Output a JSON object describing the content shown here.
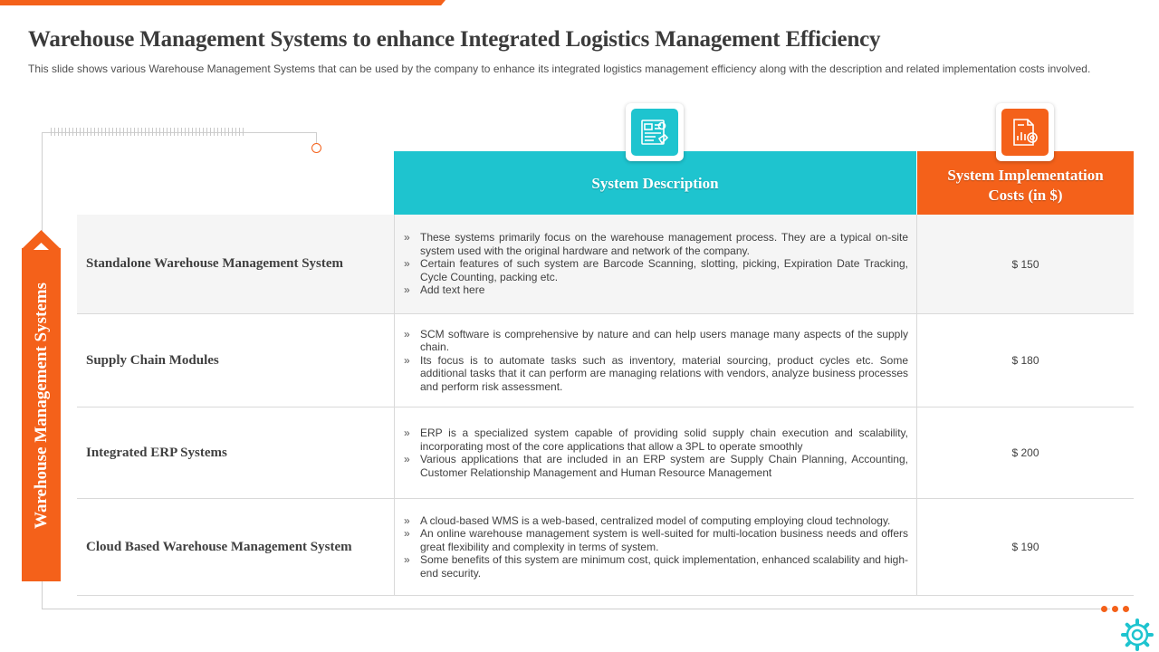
{
  "title": "Warehouse Management Systems to enhance Integrated Logistics Management Efficiency",
  "subtitle": "This slide shows various  Warehouse Management  Systems that can be used by the company to enhance its integrated  logistics management  efficiency along with the description and related implementation costs involved.",
  "banner_label": "Warehouse  Management  Systems",
  "headers": {
    "description": "System Description",
    "cost": "System Implementation Costs (in $)"
  },
  "icons": {
    "description": "document-blueprint-icon",
    "cost": "report-settings-icon"
  },
  "colors": {
    "teal": "#1ec4cf",
    "orange": "#f4611a"
  },
  "rows": [
    {
      "name": "Standalone Warehouse Management System",
      "bullets": [
        "These systems primarily focus on the warehouse management process. They are a typical on-site system used with the original hardware and network of the company.",
        "Certain features of such system are Barcode Scanning, slotting, picking, Expiration Date Tracking, Cycle Counting, packing etc.",
        "Add text here"
      ],
      "cost": "$ 150"
    },
    {
      "name": "Supply  Chain Modules",
      "bullets": [
        "SCM software is comprehensive by nature and can help users manage many aspects of the supply chain.",
        "Its focus is to automate tasks such as inventory, material sourcing, product cycles etc. Some additional tasks that it can perform are managing relations with vendors, analyze business processes and perform risk assessment."
      ],
      "cost": "$ 180"
    },
    {
      "name": "Integrated  ERP Systems",
      "bullets": [
        "ERP is a specialized system capable of providing solid supply chain execution and scalability, incorporating most of the core applications that allow a 3PL to operate smoothly",
        "Various applications that are included in an ERP system are Supply Chain Planning, Accounting, Customer Relationship Management and Human Resource Management"
      ],
      "cost": "$ 200"
    },
    {
      "name": "Cloud  Based Warehouse  Management  System",
      "bullets": [
        "A cloud-based WMS is a web-based, centralized model of computing employing cloud technology.",
        "An online warehouse management system is well-suited for multi-location business needs and offers great flexibility and complexity in terms of system.",
        "Some benefits of this system are minimum cost, quick implementation, enhanced scalability and high-end security."
      ],
      "cost": "$ 190"
    }
  ]
}
